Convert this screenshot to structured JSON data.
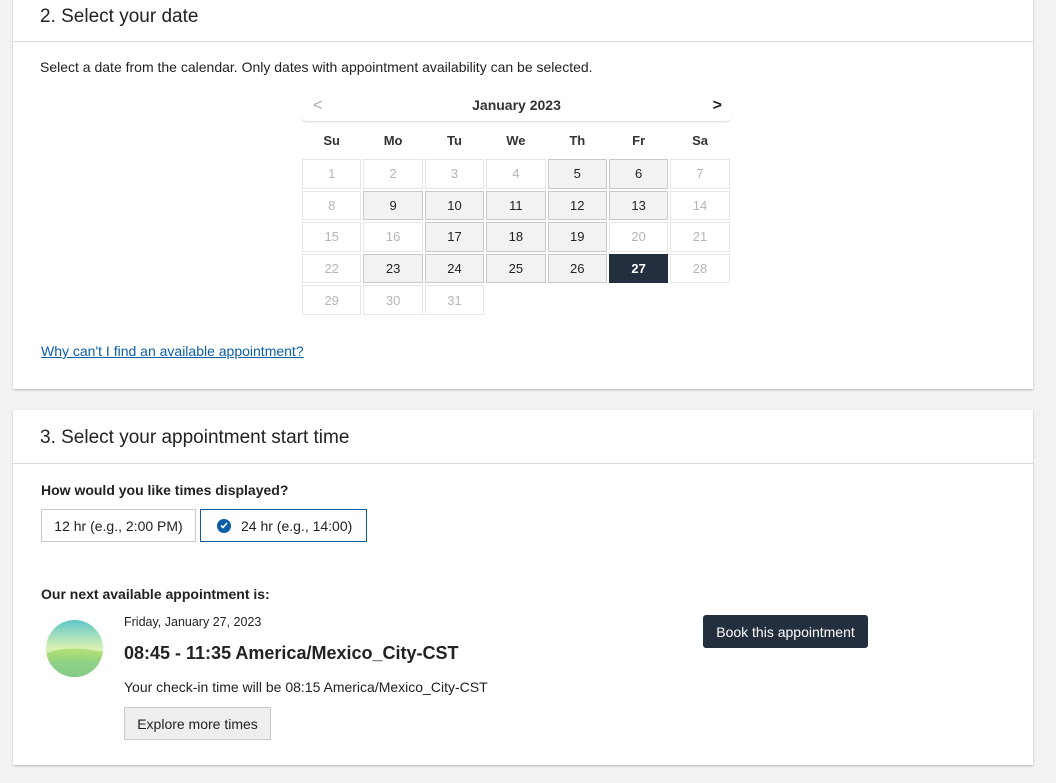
{
  "date_section": {
    "title": "2. Select your date",
    "instruction": "Select a date from the calendar. Only dates with appointment availability can be selected.",
    "help_link": "Why can't I find an available appointment?",
    "calendar": {
      "month_label": "January 2023",
      "prev": "<",
      "next": ">",
      "weekdays": [
        "Su",
        "Mo",
        "Tu",
        "We",
        "Th",
        "Fr",
        "Sa"
      ],
      "start_offset": 0,
      "days_in_month": 31,
      "available_days": [
        5,
        6,
        9,
        10,
        11,
        12,
        13,
        17,
        18,
        19,
        23,
        24,
        25,
        26,
        27
      ],
      "selected_day": 27
    }
  },
  "time_section": {
    "title": "3. Select your appointment start time",
    "format_question": "How would you like times displayed?",
    "format_12": "12 hr (e.g., 2:00 PM)",
    "format_24": "24 hr (e.g., 14:00)",
    "selected_format": "24",
    "next_label": "Our next available appointment is:",
    "appointment": {
      "date": "Friday, January 27, 2023",
      "time": "08:45 - 11:35 America/Mexico_City-CST",
      "checkin": "Your check-in time will be 08:15 America/Mexico_City-CST"
    },
    "explore_button": "Explore more times",
    "book_button": "Book this appointment"
  },
  "colors": {
    "accent": "#0a5ea8",
    "selected_day_bg": "#232f3e",
    "available_day_bg": "#f2f2f2"
  }
}
